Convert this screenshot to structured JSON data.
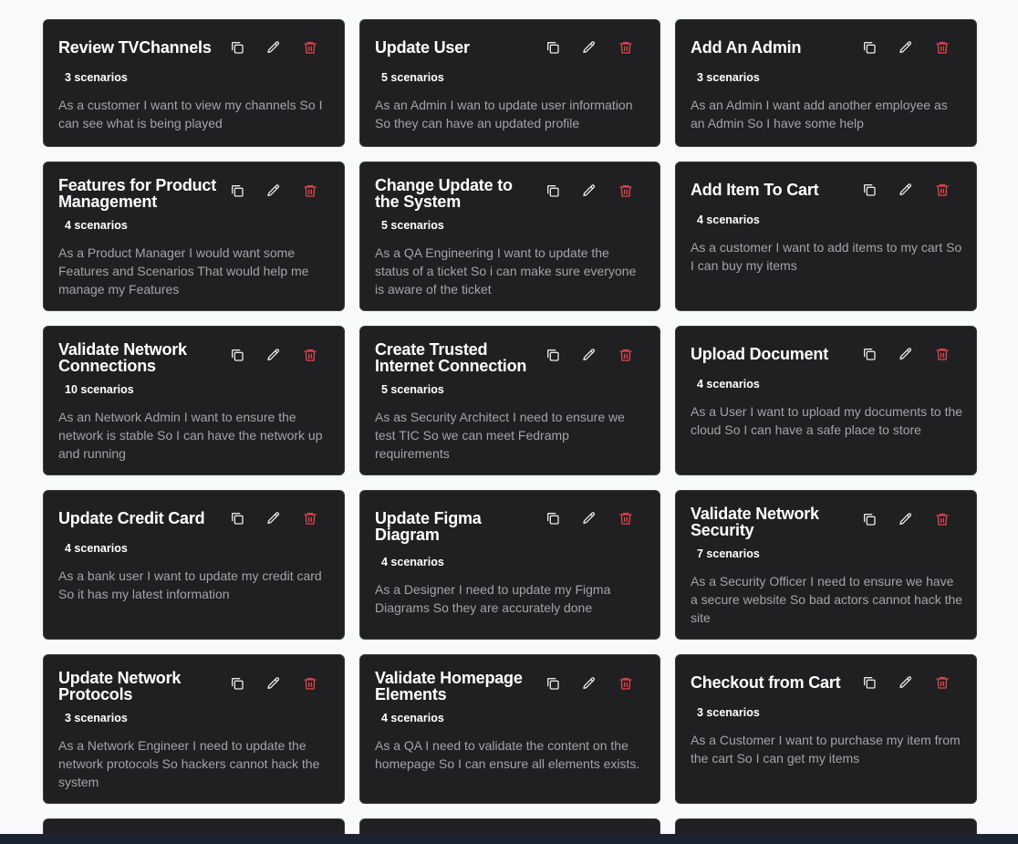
{
  "cards": [
    {
      "title": "Review TVChannels",
      "scenarios": "3 scenarios",
      "description": "As a customer I want to view my channels So I can see what is being played"
    },
    {
      "title": "Update User",
      "scenarios": "5 scenarios",
      "description": "As an Admin I wan to update user information So they can have an updated profile"
    },
    {
      "title": "Add An Admin",
      "scenarios": "3 scenarios",
      "description": "As an Admin I want add another employee as an Admin So I have some help"
    },
    {
      "title": "Features for Product Management",
      "scenarios": "4 scenarios",
      "description": "As a Product Manager I would want some Features and Scenarios That would help me manage my Features"
    },
    {
      "title": "Change Update to the System",
      "scenarios": "5 scenarios",
      "description": "As a QA Engineering I want to update the status of a ticket So i can make sure everyone is aware of the ticket"
    },
    {
      "title": "Add Item To Cart",
      "scenarios": "4 scenarios",
      "description": "As a customer I want to add items to my cart So I can buy my items"
    },
    {
      "title": "Validate Network Connections",
      "scenarios": "10 scenarios",
      "description": "As an Network Admin I want to ensure the network is stable So I can have the network up and running"
    },
    {
      "title": "Create Trusted Internet Connection",
      "scenarios": "5 scenarios",
      "description": "As as Security Architect I need to ensure we test TIC So we can meet Fedramp requirements"
    },
    {
      "title": "Upload Document",
      "scenarios": "4 scenarios",
      "description": "As a User I want to upload my documents to the cloud So I can have a safe place to store"
    },
    {
      "title": "Update Credit Card",
      "scenarios": "4 scenarios",
      "description": "As a bank user I want to update my credit card So it has my latest information"
    },
    {
      "title": "Update Figma Diagram",
      "scenarios": "4 scenarios",
      "description": "As a Designer I need to update my Figma Diagrams So they are accurately done"
    },
    {
      "title": "Validate Network Security",
      "scenarios": "7 scenarios",
      "description": "As a Security Officer I need to ensure we have a secure website So bad actors cannot hack the site"
    },
    {
      "title": "Update Network Protocols",
      "scenarios": "3 scenarios",
      "description": "As a Network Engineer I need to update the network protocols So hackers cannot hack the system"
    },
    {
      "title": "Validate Homepage Elements",
      "scenarios": "4 scenarios",
      "description": "As a QA I need to validate the content on the homepage So I can ensure all elements exists."
    },
    {
      "title": "Checkout from Cart",
      "scenarios": "3 scenarios",
      "description": "As a Customer I want to purchase my item from the cart So I can get my items"
    }
  ],
  "icons": {
    "copy": "copy-icon",
    "edit": "pencil-icon",
    "delete": "trash-icon"
  },
  "colors": {
    "background": "#f8f9fb",
    "card": "#202023",
    "delete": "#e0454b",
    "bottom_bar": "#1b2231"
  }
}
